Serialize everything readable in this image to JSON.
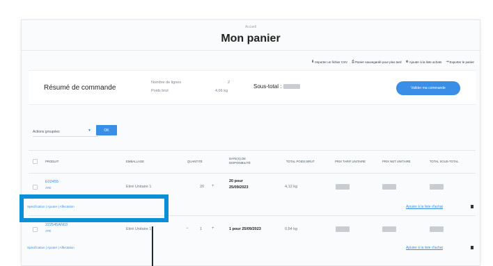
{
  "header": {
    "breadcrumb": "Accueil",
    "title": "Mon panier"
  },
  "actions": [
    {
      "icon": "download-icon",
      "label": "Importer un fichier CSV"
    },
    {
      "icon": "print-icon",
      "label": "Panier sauvegardé pour plus tard"
    },
    {
      "icon": "list-add-icon",
      "label": "Ajouter à la liste achats"
    },
    {
      "icon": "export-icon",
      "label": "Exporter le panier"
    }
  ],
  "summary": {
    "title": "Résumé de commande",
    "lines_label": "Nombre de lignes",
    "lines_value": "2",
    "weight_label": "Poids brut",
    "weight_value": "4,66 kg",
    "subtotal_label": "Sous-total :",
    "cta_label": "Valider ma commande"
  },
  "bulk": {
    "select_label": "Actions groupées",
    "ok_label": "OK"
  },
  "table": {
    "headers": {
      "product": "Produit",
      "packaging": "Emballage",
      "quantity": "Quantité",
      "availability": "Date(s) de disponibilité",
      "total_weight": "Total poids brut",
      "unit_price_ht": "Prix tarif unitaire",
      "net_unit_price": "Prix net unitaire",
      "total_ht": "Total sous-total"
    },
    "rows": [
      {
        "code": "E02455",
        "sub": "ATE",
        "packaging": "Etiré Unitaire 1",
        "quantity": "20",
        "availability_line1": "20 pour",
        "availability_line2": "25/09/2023",
        "weight": "4,12 kg",
        "links": "Spécification | Ajouter | Affectation",
        "add_to_list": "Ajouter à la liste d'achat"
      },
      {
        "code": "222545AN03",
        "sub": "ATE",
        "packaging": "Etiré Unitaire 1",
        "quantity": "1",
        "availability_line1": "1 pour 25/09/2023",
        "availability_line2": "",
        "weight": "0,54 kg",
        "links": "Spécification | Ajouter | Affectation",
        "add_to_list": "Ajouter à la liste d'achat"
      }
    ]
  },
  "colors": {
    "accent": "#3a8ee6",
    "highlight": "#0a8fd6"
  }
}
